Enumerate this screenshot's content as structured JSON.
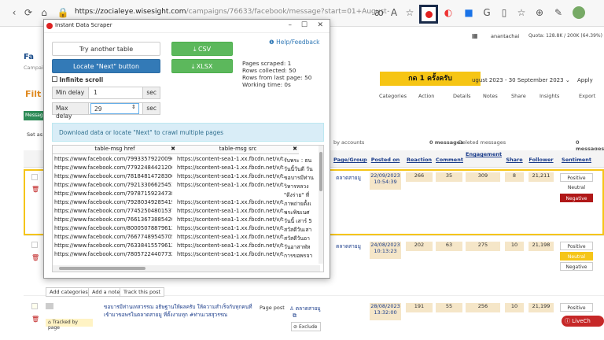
{
  "browser": {
    "url_host": "https://zocialeye.wisesight.com",
    "url_rest": "/campaigns/76633/facebook/message?start=01+August+2023&end=30+Septemb..."
  },
  "callout": {
    "text": "กด 1 ครั้งครับ"
  },
  "page": {
    "user": "anantachai",
    "quota": "Quota: 128.8K / 200K (64.39%)",
    "facebook_label": "Fa",
    "campaign_label": "Campaig",
    "filter_label": "Filt",
    "message_tab": "Message",
    "set_as": "Set as :",
    "date_range": "ugust 2023 - 30 September 2023",
    "apply": "Apply",
    "tools": [
      "Categories",
      "Action",
      "Details",
      "Notes",
      "Share",
      "Insights",
      "Export"
    ],
    "stats": {
      "by_accounts": "by accounts",
      "messages": "0 messages",
      "deleted": "Deleted messages",
      "messages2": "0 messages"
    },
    "headers": [
      "Page/Group",
      "Posted on",
      "Reaction",
      "Comment",
      "Engagement",
      "Share",
      "Follower",
      "Sentiment"
    ],
    "rows": [
      {
        "page": "ตลาดสายมู",
        "posted": "22/09/2023 10:54:39",
        "reaction": "266",
        "comment": "35",
        "engagement": "309",
        "share": "8",
        "follower": "21,211",
        "sentiments": [
          "Positive",
          "Neutral",
          "Negative"
        ],
        "active": "Negative"
      },
      {
        "page": "ตลาดสายมู",
        "posted": "24/08/2023 10:13:23",
        "reaction": "202",
        "comment": "63",
        "engagement": "275",
        "share": "10",
        "follower": "21,198",
        "sentiments": [
          "Positive",
          "Neutral",
          "Negative"
        ],
        "active": "Neutral"
      },
      {
        "page": "ตลาดสายมู",
        "posted": "28/08/2023 13:32:00",
        "reaction": "191",
        "comment": "55",
        "engagement": "256",
        "share": "10",
        "follower": "21,199",
        "sentiments": [
          "Positive"
        ],
        "active": "Positive",
        "post_text1": "ขอบารมีท่านเทสวรรณ อธิษฐานให้ผลครับ ให้ความสำเร็จกับทุกคนที่",
        "post_text2": "เข้ามาขอพรในตลาดสายมู ที่ตั้งงามทุก #ท่านเวสสุวรรณ",
        "post_type": "Page post",
        "exclude": "Exclude",
        "tracked": "Tracked by page"
      }
    ],
    "bottom_buttons": [
      "Add categories",
      "Add a note",
      "Track this post"
    ],
    "livechat": "LiveCh"
  },
  "popup": {
    "title": "Instant Data Scraper",
    "help": "Help/Feedback",
    "try_another": "Try another table",
    "csv": "CSV",
    "xlsx": "XLSX",
    "locate_next": "Locate \"Next\" button",
    "infinite_scroll": "Infinite scroll",
    "min_delay_label": "Min delay",
    "min_delay_value": "1",
    "max_delay_label": "Max delay",
    "max_delay_value": "29",
    "unit": "sec",
    "pages_scraped": "Pages scraped: 1",
    "rows_collected": "Rows collected: 50",
    "rows_from_last": "Rows from last page: 50",
    "working_time": "Working time: 0s",
    "info": "Download data or locate \"Next\" to crawl multiple pages",
    "col1": "table-msg href",
    "col2": "table-msg src",
    "rows": [
      {
        "href": "https://www.facebook.com/799335792200965",
        "src": "https://scontent-sea1-1.xx.fbcdn.net/v/t39.30808",
        "text": "รับพระ : ธน"
      },
      {
        "href": "https://www.facebook.com/779224844212060",
        "src": "https://scontent-sea1-1.xx.fbcdn.net/v/t39.30808",
        "text": "วันนี้วันดี วัน"
      },
      {
        "href": "https://www.facebook.com/781848147283063",
        "src": "https://scontent-sea1-1.xx.fbcdn.net/v/t39.30808",
        "text": "ขอบารมีท่าน"
      },
      {
        "href": "https://www.facebook.com/792133066254511",
        "src": "https://scontent-sea1-1.xx.fbcdn.net/v/t39.30808",
        "text": "วิหารหลวง"
      },
      {
        "href": "https://www.facebook.com/797871592347385",
        "src": "",
        "text": "\"ดึงร่าย\" ที่"
      },
      {
        "href": "https://www.facebook.com/792803492854195",
        "src": "https://scontent-sea1-1.xx.fbcdn.net/v/t39.30808",
        "text": "ภาพถ่ายตั้งเ"
      },
      {
        "href": "https://www.facebook.com/774525048015373",
        "src": "https://scontent-sea1-1.xx.fbcdn.net/v/t39.30808",
        "text": "พระพิฆเนศ"
      },
      {
        "href": "https://www.facebook.com/766136738854204",
        "src": "https://scontent-sea1-1.xx.fbcdn.net/v/t39.30808",
        "text": "วันนี้ เสาร์ 5"
      },
      {
        "href": "https://www.facebook.com/800050788796132",
        "src": "https://scontent-sea1-1.xx.fbcdn.net/v/t39.30808",
        "text": "สวัสดีวันเสา"
      },
      {
        "href": "https://www.facebook.com/766774895457055",
        "src": "https://scontent-sea1-1.xx.fbcdn.net/v/t39.30808",
        "text": "สวัสดีวันอา"
      },
      {
        "href": "https://www.facebook.com/763384155796129",
        "src": "https://scontent-sea1-1.xx.fbcdn.net/v/t39.30808",
        "text": "วันอาสาฬห"
      },
      {
        "href": "https://www.facebook.com/780572244077320",
        "src": "https://scontent-sea1-1.xx.fbcdn.net/v/t39.30808",
        "text": "การขอพรจา"
      }
    ]
  }
}
